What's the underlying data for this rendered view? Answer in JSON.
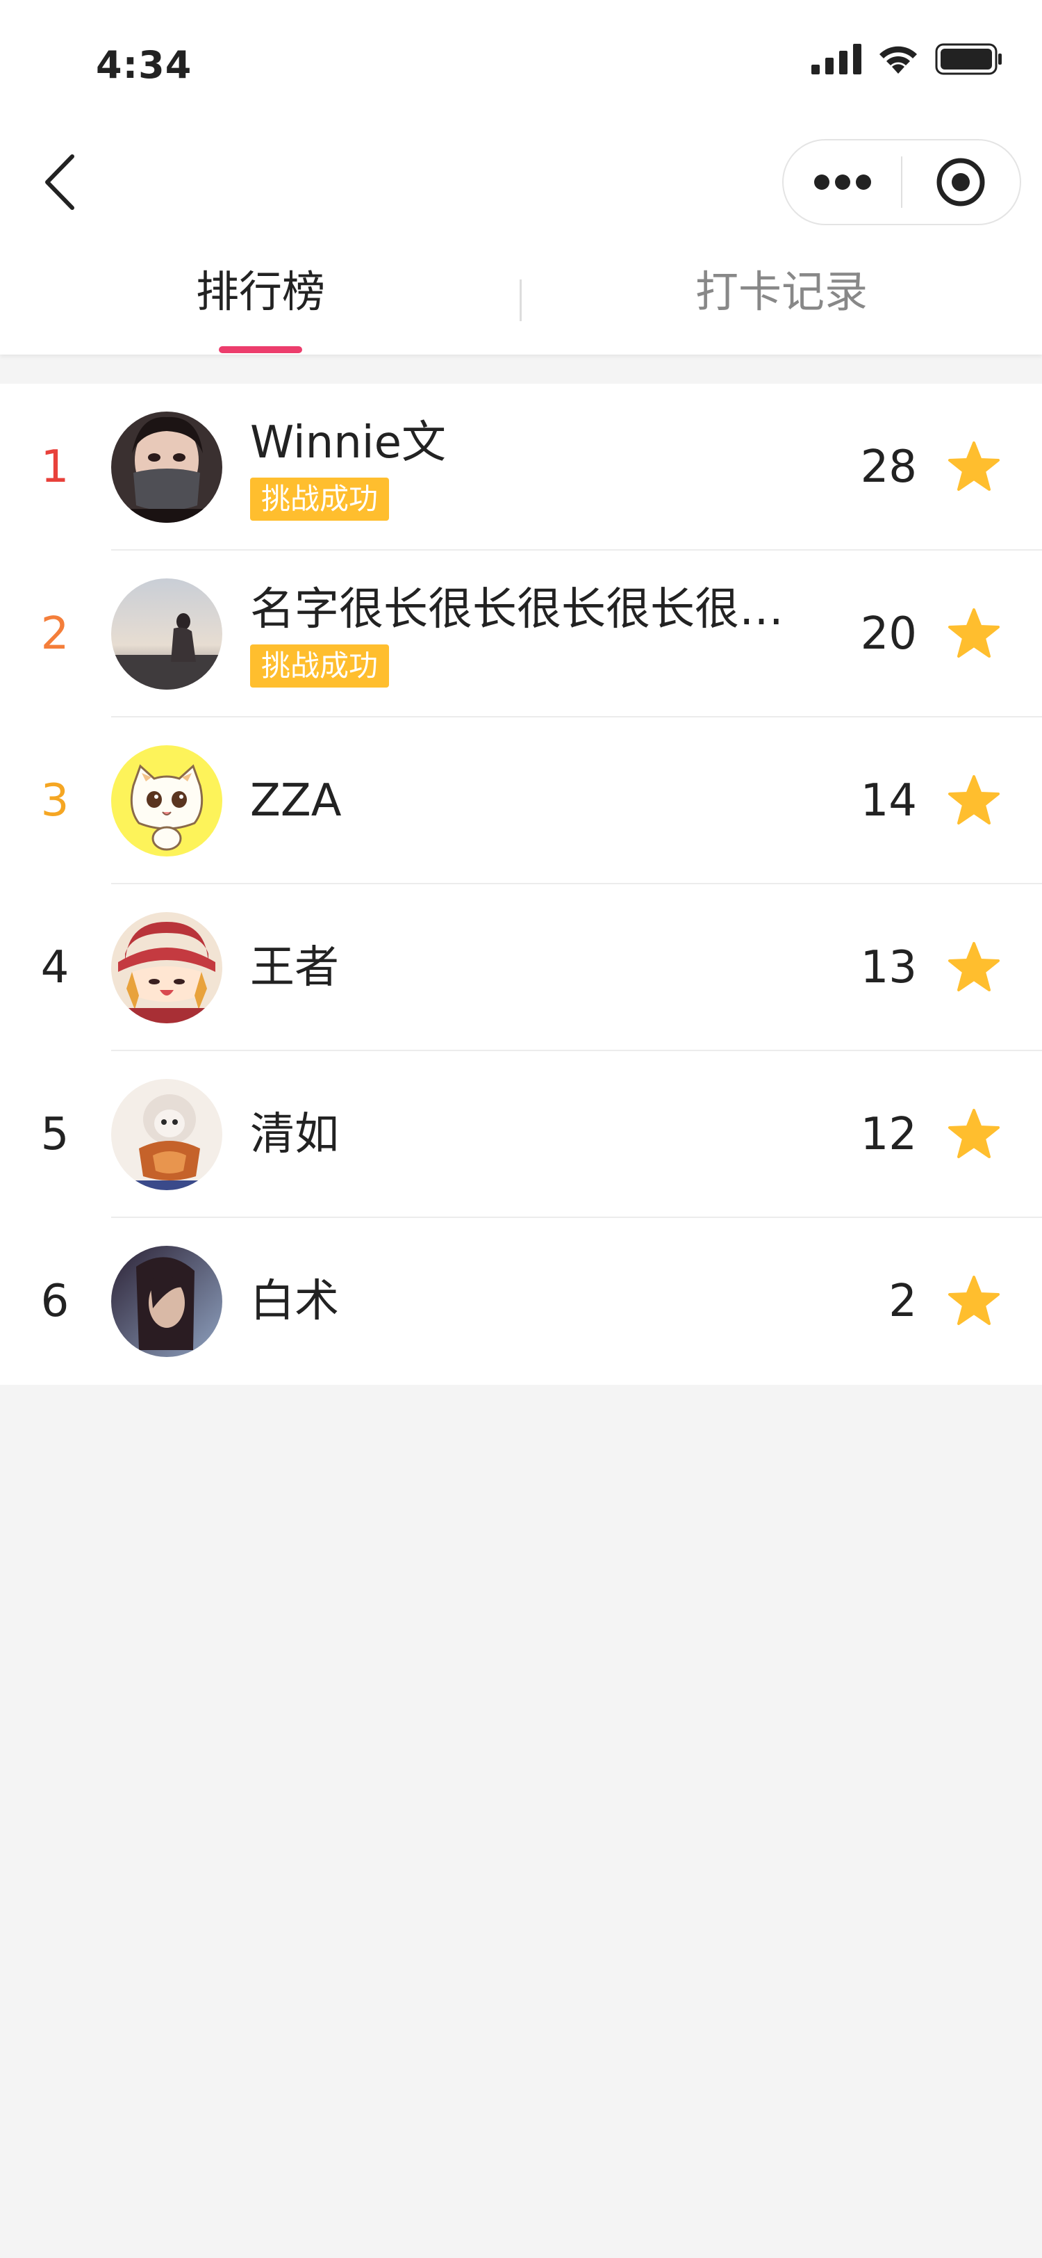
{
  "status_bar": {
    "time": "4:34",
    "icons": [
      "signal-icon",
      "wifi-icon",
      "battery-icon"
    ]
  },
  "nav": {
    "icons": [
      "back-arrow-icon",
      "more-dots-icon",
      "close-target-icon"
    ]
  },
  "tabs": [
    {
      "label": "排行榜",
      "active": true
    },
    {
      "label": "打卡记录",
      "active": false
    }
  ],
  "colors": {
    "tab_underline": "#ec3d6c",
    "rank_1": "#e8413b",
    "rank_2": "#f47e3a",
    "rank_3": "#f5a623",
    "badge_bg": "#ffbe2e",
    "star": "#ffbe2e"
  },
  "rankings": [
    {
      "rank": "1",
      "name": "Winnie文",
      "badge": "挑战成功",
      "score": "28"
    },
    {
      "rank": "2",
      "name": "名字很长很长很长很长很长很…",
      "badge": "挑战成功",
      "score": "20"
    },
    {
      "rank": "3",
      "name": "ZZA",
      "badge": "",
      "score": "14"
    },
    {
      "rank": "4",
      "name": "王者",
      "badge": "",
      "score": "13"
    },
    {
      "rank": "5",
      "name": "清如",
      "badge": "",
      "score": "12"
    },
    {
      "rank": "6",
      "name": "白术",
      "badge": "",
      "score": "2"
    }
  ]
}
